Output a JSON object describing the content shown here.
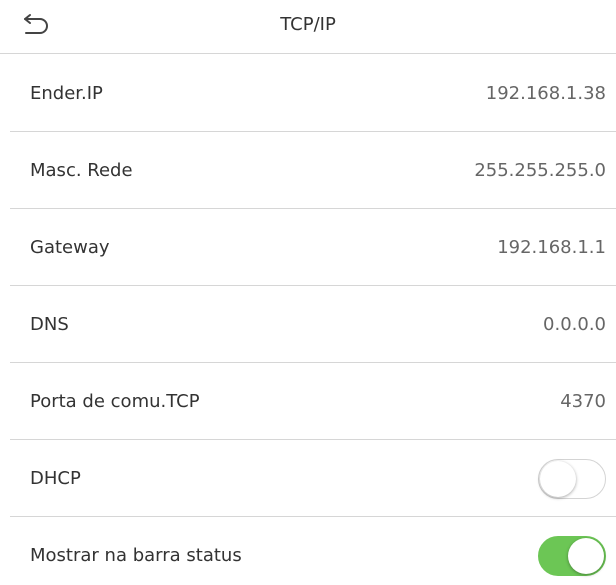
{
  "header": {
    "title": "TCP/IP",
    "back_icon": "back-arrow-icon"
  },
  "rows": [
    {
      "label": "Ender.IP",
      "value": "192.168.1.38"
    },
    {
      "label": "Masc. Rede",
      "value": "255.255.255.0"
    },
    {
      "label": "Gateway",
      "value": "192.168.1.1"
    },
    {
      "label": "DNS",
      "value": "0.0.0.0"
    },
    {
      "label": "Porta de comu.TCP",
      "value": "4370"
    }
  ],
  "toggles": [
    {
      "label": "DHCP",
      "state": "off"
    },
    {
      "label": "Mostrar na barra status",
      "state": "on"
    }
  ],
  "colors": {
    "toggle_on": "#6cc655",
    "divider": "#d6d6d6"
  }
}
